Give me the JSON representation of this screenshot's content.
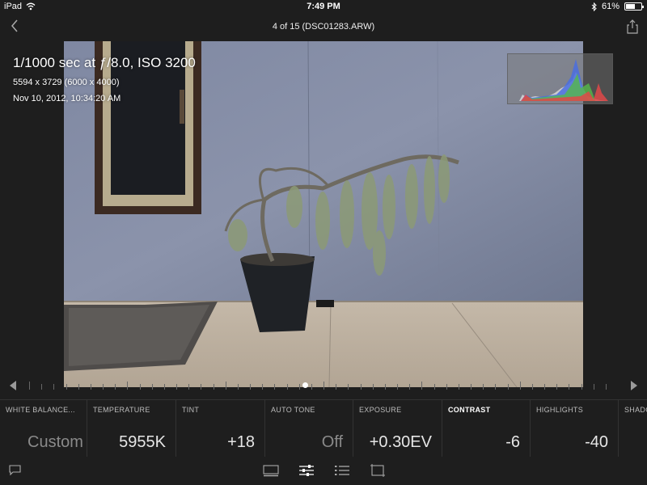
{
  "status": {
    "device": "iPad",
    "time": "7:49 PM",
    "battery": "61%",
    "battery_level": 0.61
  },
  "nav": {
    "title": "4 of 15 (DSC01283.ARW)"
  },
  "photo_info": {
    "exposure": "1/1000 sec at ƒ/8.0, ISO 3200",
    "dimensions": "5594 x 3729 (6000 x 4000)",
    "date": "Nov 10, 2012, 10:34:20 AM"
  },
  "adjustments": [
    {
      "label": "WHITE BALANCE...",
      "value": "Custom"
    },
    {
      "label": "TEMPERATURE",
      "value": "5955K"
    },
    {
      "label": "TINT",
      "value": "+18"
    },
    {
      "label": "AUTO TONE",
      "value": "Off"
    },
    {
      "label": "EXPOSURE",
      "value": "+0.30EV"
    },
    {
      "label": "CONTRAST",
      "value": "-6"
    },
    {
      "label": "HIGHLIGHTS",
      "value": "-40"
    },
    {
      "label": "SHADO"
    }
  ],
  "icons": {
    "back": "chevron-left-icon",
    "share": "share-icon",
    "flag": "flag-icon",
    "filmstrip": "filmstrip-icon",
    "adjust": "sliders-icon",
    "presets": "list-icon",
    "crop": "crop-icon"
  }
}
